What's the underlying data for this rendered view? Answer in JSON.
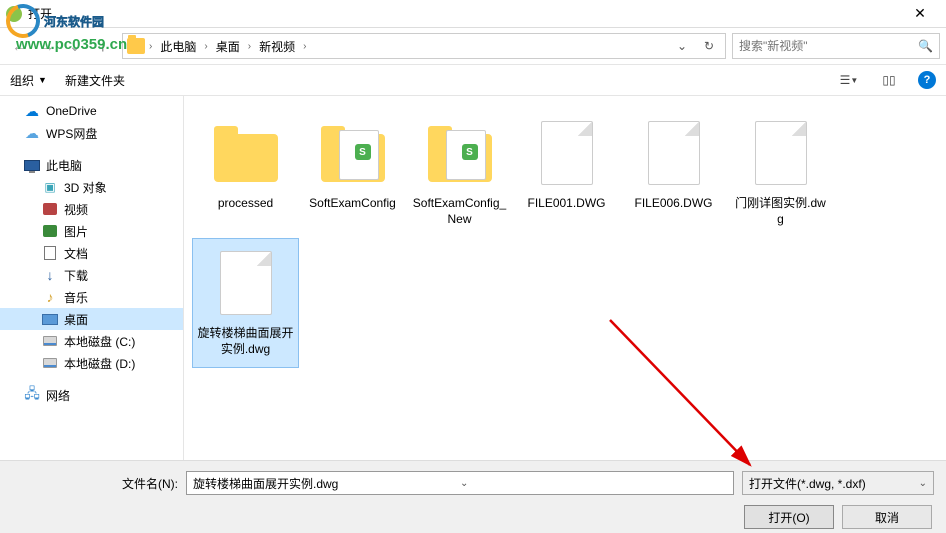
{
  "window": {
    "title": "打开"
  },
  "watermark": {
    "title": "河东软件园",
    "url": "www.pc0359.cn"
  },
  "breadcrumb": {
    "items": [
      "此电脑",
      "桌面",
      "新视频"
    ]
  },
  "search": {
    "placeholder": "搜索\"新视频\""
  },
  "toolbar": {
    "organize": "组织",
    "newfolder": "新建文件夹"
  },
  "sidebar": {
    "onedrive": "OneDrive",
    "wps": "WPS网盘",
    "pc": "此电脑",
    "obj3d": "3D 对象",
    "video": "视频",
    "pic": "图片",
    "doc": "文档",
    "download": "下载",
    "music": "音乐",
    "desktop": "桌面",
    "diskc": "本地磁盘 (C:)",
    "diskd": "本地磁盘 (D:)",
    "network": "网络"
  },
  "files": [
    {
      "name": "processed",
      "type": "folder"
    },
    {
      "name": "SoftExamConfig",
      "type": "folder-file"
    },
    {
      "name": "SoftExamConfig_New",
      "type": "folder-file"
    },
    {
      "name": "FILE001.DWG",
      "type": "file"
    },
    {
      "name": "FILE006.DWG",
      "type": "file"
    },
    {
      "name": "门刚详图实例.dwg",
      "type": "file"
    },
    {
      "name": "旋转楼梯曲面展开实例.dwg",
      "type": "file",
      "selected": true
    }
  ],
  "footer": {
    "filelabel": "文件名(N):",
    "filename": "旋转楼梯曲面展开实例.dwg",
    "filter": "打开文件(*.dwg, *.dxf)",
    "open": "打开(O)",
    "cancel": "取消"
  }
}
